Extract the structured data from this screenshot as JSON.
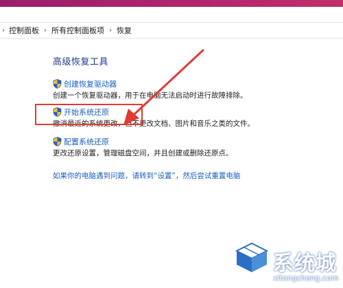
{
  "breadcrumb": {
    "items": [
      "控制面板",
      "所有控制面板项",
      "恢复"
    ]
  },
  "main": {
    "title": "高级恢复工具",
    "tasks": [
      {
        "link": "创建恢复驱动器",
        "desc": "创建一个恢复驱动器，用于在电脑无法启动时进行故障排除。",
        "icon": "uac-shield-icon"
      },
      {
        "link": "开始系统还原",
        "desc": "撤消最近的系统更改，但不更改文档、图片和音乐之类的文件。",
        "icon": "uac-shield-icon"
      },
      {
        "link": "配置系统还原",
        "desc": "更改还原设置，管理磁盘空间，并且创建或删除还原点。",
        "icon": "uac-shield-icon"
      }
    ],
    "bottom_link": "如果你的电脑遇到问题，请转到“设置”，然后尝试重置电脑"
  },
  "annotation": {
    "color": "#e03a32"
  },
  "watermark": {
    "brand": "系统城",
    "domain": "xitongcheng.com"
  },
  "colors": {
    "link": "#1b5fc1",
    "title": "#1e3a8a",
    "titlebar": "#b3256d"
  }
}
